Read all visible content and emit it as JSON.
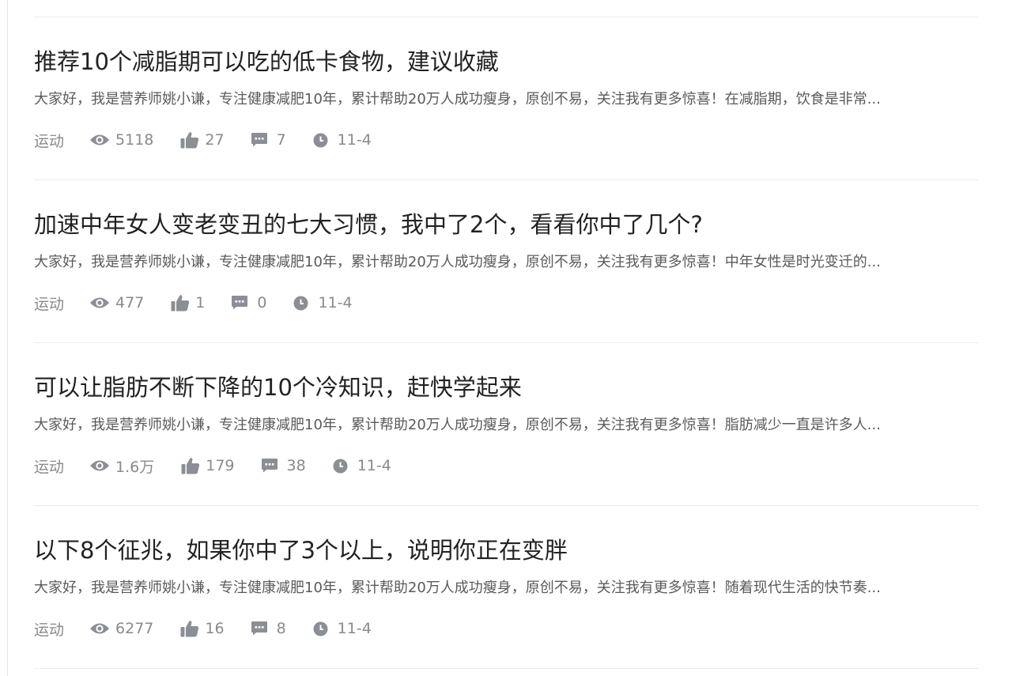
{
  "articles": [
    {
      "title": "推荐10个减脂期可以吃的低卡食物，建议收藏",
      "summary": "大家好，我是营养师姚小谦，专注健康减肥10年，累计帮助20万人成功瘦身，原创不易，关注我有更多惊喜！在减脂期，饮食是非常...",
      "category": "运动",
      "views": "5118",
      "likes": "27",
      "comments": "7",
      "date": "11-4"
    },
    {
      "title": "加速中年女人变老变丑的七大习惯，我中了2个，看看你中了几个?",
      "summary": "大家好，我是营养师姚小谦，专注健康减肥10年，累计帮助20万人成功瘦身，原创不易，关注我有更多惊喜！中年女性是时光变迁的...",
      "category": "运动",
      "views": "477",
      "likes": "1",
      "comments": "0",
      "date": "11-4"
    },
    {
      "title": "可以让脂肪不断下降的10个冷知识，赶快学起来",
      "summary": "大家好，我是营养师姚小谦，专注健康减肥10年，累计帮助20万人成功瘦身，原创不易，关注我有更多惊喜！脂肪减少一直是许多人...",
      "category": "运动",
      "views": "1.6万",
      "likes": "179",
      "comments": "38",
      "date": "11-4"
    },
    {
      "title": "以下8个征兆，如果你中了3个以上，说明你正在变胖",
      "summary": "大家好，我是营养师姚小谦，专注健康减肥10年，累计帮助20万人成功瘦身，原创不易，关注我有更多惊喜！随着现代生活的快节奏...",
      "category": "运动",
      "views": "6277",
      "likes": "16",
      "comments": "8",
      "date": "11-4"
    }
  ],
  "icons": {
    "views": "eye-icon",
    "likes": "thumbs-up-icon",
    "comments": "comment-icon",
    "date": "clock-icon"
  },
  "colors": {
    "title": "#222222",
    "summary": "#5a5a5a",
    "meta": "#8a8a8a",
    "icon": "#8a8f96",
    "divider": "#ececec"
  }
}
